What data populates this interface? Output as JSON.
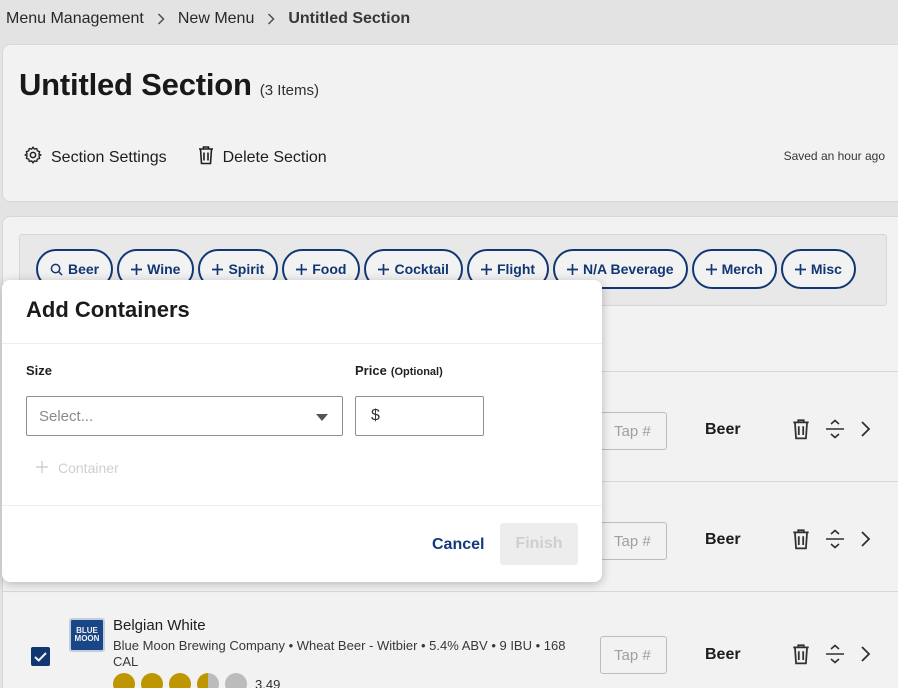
{
  "breadcrumb": {
    "items": [
      "Menu Management",
      "New Menu",
      "Untitled Section"
    ]
  },
  "section": {
    "title": "Untitled Section",
    "item_count": "(3 Items)",
    "settings_label": "Section Settings",
    "delete_label": "Delete Section",
    "saved_status": "Saved an hour ago"
  },
  "chips": [
    {
      "label": "Beer",
      "icon": "search-icon"
    },
    {
      "label": "Wine",
      "icon": "plus-icon"
    },
    {
      "label": "Spirit",
      "icon": "plus-icon"
    },
    {
      "label": "Food",
      "icon": "plus-icon"
    },
    {
      "label": "Cocktail",
      "icon": "plus-icon"
    },
    {
      "label": "Flight",
      "icon": "plus-icon"
    },
    {
      "label": "N/A Beverage",
      "icon": "plus-icon"
    },
    {
      "label": "Merch",
      "icon": "plus-icon"
    },
    {
      "label": "Misc",
      "icon": "plus-icon"
    }
  ],
  "rows": [
    {
      "tap_placeholder": "Tap #",
      "type": "Beer"
    },
    {
      "tap_placeholder": "Tap #",
      "type": "Beer"
    },
    {
      "tap_placeholder": "Tap #",
      "type": "Beer",
      "checked": true,
      "logo_text": "BLUE MOON",
      "name": "Belgian White",
      "description": "Blue Moon Brewing Company • Wheat Beer - Witbier • 5.4% ABV • 9 IBU • 168 CAL",
      "rating": "3.49"
    }
  ],
  "modal": {
    "title": "Add Containers",
    "size_label": "Size",
    "price_label": "Price",
    "price_optional": "(Optional)",
    "size_placeholder": "Select...",
    "currency_symbol": "$",
    "price_value": "",
    "add_container_label": "Container",
    "cancel_label": "Cancel",
    "finish_label": "Finish"
  },
  "colors": {
    "accent": "#123a7a",
    "star": "#c9a000",
    "disabled": "#cfcfcf"
  }
}
